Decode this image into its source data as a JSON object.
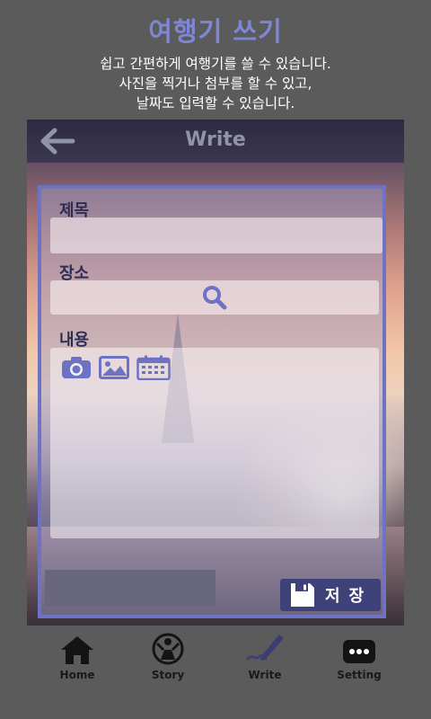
{
  "header": {
    "title": "여행기 쓰기",
    "desc_line1": "쉽고 간편하게 여행기를 쓸 수 있습니다.",
    "desc_line2": "사진을 찍거나 첨부를 할 수 있고,",
    "desc_line3": "날짜도 입력할 수 있습니다."
  },
  "appbar": {
    "title": "Write",
    "back_icon": "arrow-left-icon"
  },
  "form": {
    "title_label": "제목",
    "title_value": "",
    "place_label": "장소",
    "place_value": "",
    "content_label": "내용",
    "content_value": "",
    "tools": [
      "camera-icon",
      "image-icon",
      "calendar-icon"
    ],
    "save_label": "저장",
    "accent_color": "#6e72c4",
    "save_color": "#3f4279"
  },
  "nav": {
    "items": [
      {
        "label": "Home",
        "icon": "home-icon"
      },
      {
        "label": "Story",
        "icon": "story-icon"
      },
      {
        "label": "Write",
        "icon": "pen-icon"
      },
      {
        "label": "Setting",
        "icon": "more-icon"
      }
    ]
  }
}
